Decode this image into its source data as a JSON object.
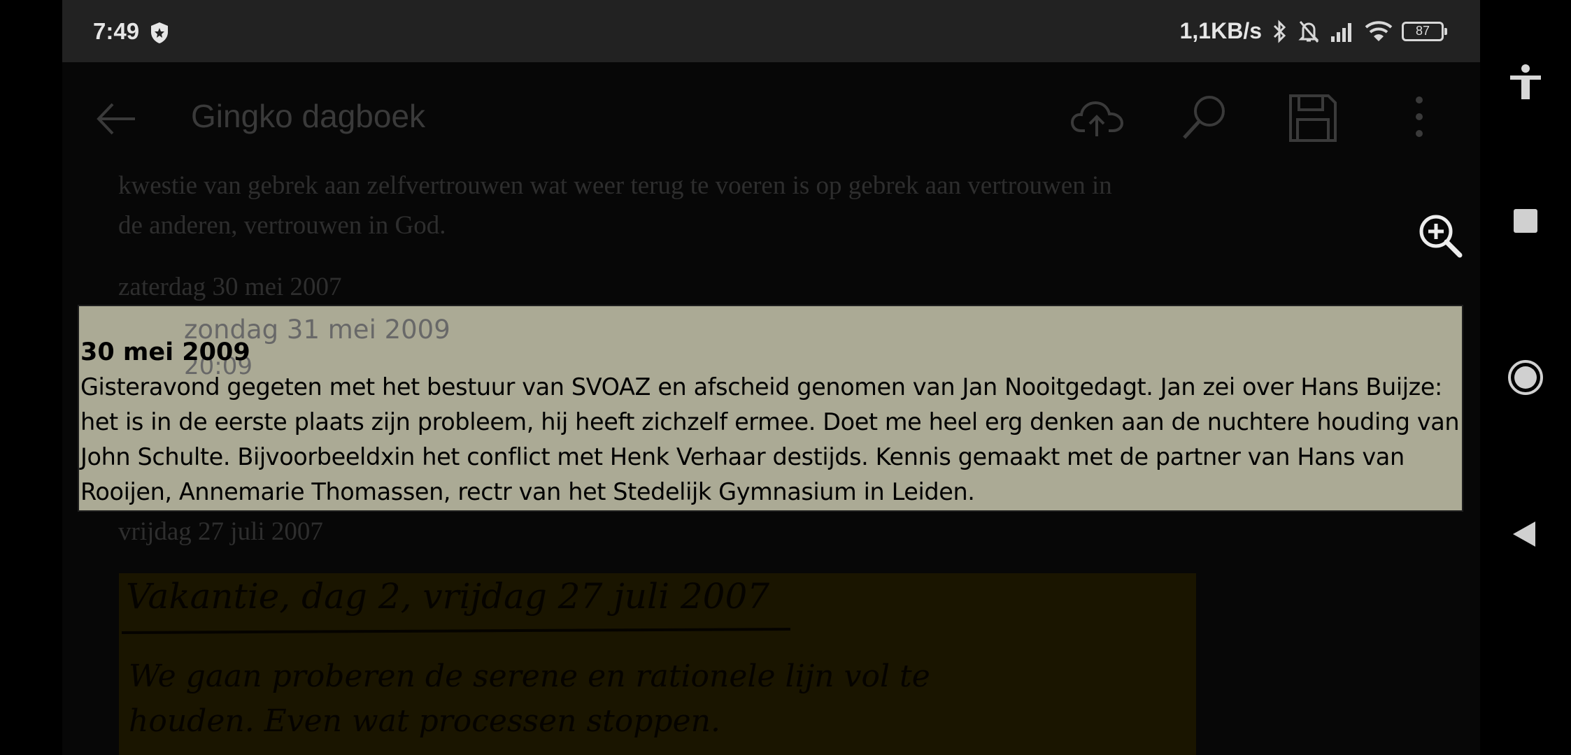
{
  "status_bar": {
    "time": "7:49",
    "speed": "1,1KB/s",
    "battery": "87",
    "icons": [
      "shield-icon",
      "bluetooth-icon",
      "mute-icon",
      "signal-icon",
      "wifi-icon",
      "battery-icon"
    ]
  },
  "toolbar": {
    "title": "Gingko dagboek",
    "icons": [
      "back-arrow-icon",
      "cloud-upload-icon",
      "search-icon",
      "save-icon",
      "more-vert-icon"
    ]
  },
  "document": {
    "intro_line1": "kwestie van gebrek aan zelfvertrouwen wat weer terug te voeren is op gebrek aan vertrouwen in",
    "intro_line2": "de anderen, vertrouwen in God.",
    "entry_date_1": "zaterdag 30 mei 2007",
    "entry_date_2": "vrijdag 27 juli 2007",
    "handwriting_lines": [
      "Vakantie, dag 2, vrijdag 27 juli 2007",
      "We gaan proberen de serene en rationele lijn vol te",
      "houden. Even wat processen stoppen."
    ]
  },
  "popup": {
    "date": "zondag 31 mei 2009",
    "time": "20:09",
    "heading": "30 mei 2009",
    "body": "Gisteravond gegeten met het bestuur van SVOAZ en afscheid genomen van Jan Nooitgedagt. Jan zei over Hans Buijze: het is in de eerste plaats zijn probleem, hij heeft zichzelf ermee. Doet me heel erg denken aan de nuchtere houding van John Schulte. Bijvoorbeeldxin het conflict met Henk Verhaar destijds. Kennis gemaakt met de partner van Hans van Rooijen, Annemarie Thomassen, rectr van het Stedelijk Gymnasium in Leiden."
  },
  "zoom": {
    "icon": "zoom-in-icon"
  },
  "nav_bar": {
    "icons": [
      "accessibility-icon",
      "recents-square-icon",
      "home-circle-icon",
      "back-triangle-icon"
    ]
  },
  "colors": {
    "popup_bg": "#abaa95",
    "status_bg": "#222222",
    "note_bg": "#1a1500"
  }
}
